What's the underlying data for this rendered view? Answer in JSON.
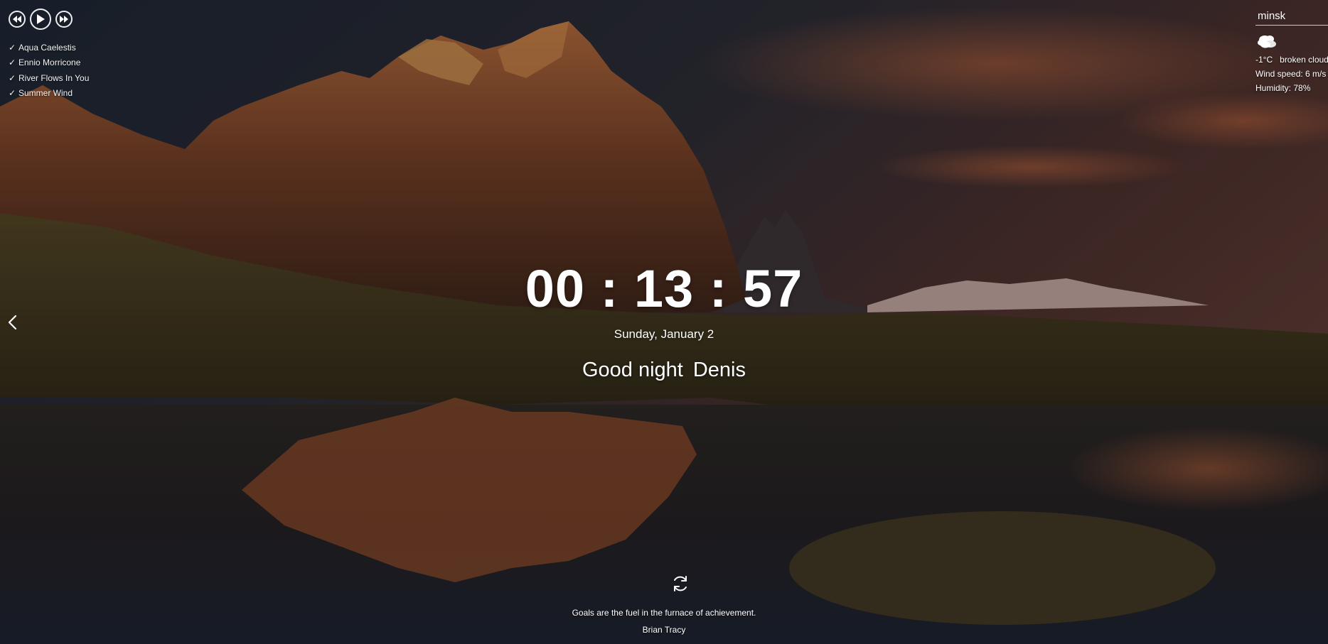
{
  "player": {
    "controls": [
      "previous-track",
      "play",
      "next-track"
    ],
    "playlist": [
      {
        "title": "Aqua Caelestis",
        "check": "✓"
      },
      {
        "title": "Ennio Morricone",
        "check": "✓"
      },
      {
        "title": "River Flows In You",
        "check": "✓"
      },
      {
        "title": "Summer Wind",
        "check": "✓"
      }
    ]
  },
  "weather": {
    "city": "minsk",
    "icon": "broken-clouds-icon",
    "temperature": "-1°C",
    "description": "broken clouds",
    "wind": "Wind speed: 6 m/s",
    "humidity": "Humidity: 78%"
  },
  "slider": {
    "prev_icon": "chevron-left-icon"
  },
  "time": {
    "hours": "00",
    "minutes": "13",
    "seconds": "57",
    "separator": ":"
  },
  "date": "Sunday, January 2",
  "greeting": {
    "text": "Good night",
    "name": "Denis"
  },
  "quote": {
    "refresh_icon": "refresh-icon",
    "text": "Goals are the fuel in the furnace of achievement.",
    "author": "Brian Tracy"
  },
  "colors": {
    "text": "#ffffff",
    "sky_dark": "#1f2636",
    "sunset": "#b0552a"
  }
}
